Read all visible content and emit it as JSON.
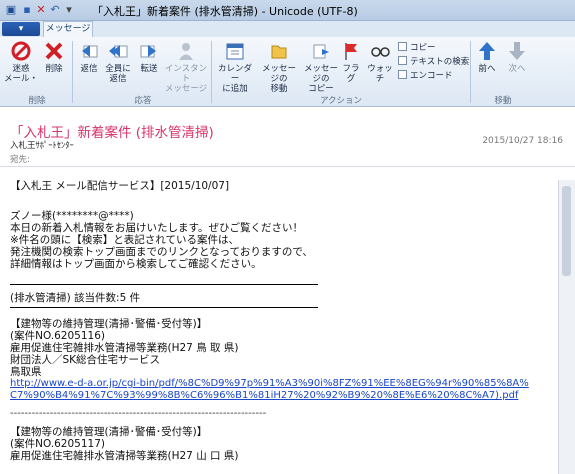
{
  "window": {
    "title": "「入札王」新着案件 (排水管清掃) - Unicode (UTF-8)"
  },
  "ribbon": {
    "file_tab": "▾",
    "active_tab": "メッセージ",
    "groups": {
      "delete": "削除",
      "respond": "応答",
      "actions": "アクション",
      "move": "移動"
    },
    "buttons": {
      "junk_1": "迷惑",
      "junk_2": "メール・",
      "delete": "削除",
      "reply": "返信",
      "reply_all_1": "全員に",
      "reply_all_2": "返信",
      "forward": "転送",
      "im_1": "インスタント",
      "im_2": "メッセージ",
      "calendar_1": "カレンダー",
      "calendar_2": "に追加",
      "move_msg_1": "メッセージの",
      "move_msg_2": "移動",
      "copy_msg_1": "メッセージの",
      "copy_msg_2": "コピー",
      "flag": "フラグ",
      "watch": "ウォッチ",
      "copy": "コピー",
      "find_text": "テキストの検索",
      "encode": "エンコード",
      "prev": "前へ",
      "next": "次へ"
    }
  },
  "message": {
    "subject": "「入札王」新着案件 (排水管清掃)",
    "sender": "入札王ｻﾎﾟｰﾄｾﾝﾀｰ",
    "date": "2015/10/27 18:16",
    "to_label": "宛先:"
  },
  "body": {
    "header": "【入札王 メール配信サービス】[2015/10/07]",
    "greeting": "ズノー様(********@****)",
    "intro": [
      "本日の新着入札情報をお届けいたします。ぜひご覧ください！",
      "※件名の頭に【検索】と表記されている案件は、",
      "発注機関の検索トップ画面までのリンクとなっておりますので、",
      "詳細情報はトップ画面から検索してご確認ください。"
    ],
    "summary": "(排水管清掃) 該当件数:5 件",
    "items": [
      {
        "title": "【建物等の維持管理(清掃･警備･受付等)】",
        "case": "(案件NO.6205116)",
        "name": "雇用促進住宅雑排水管清掃等業務(H27 鳥 取 県)",
        "org": "財団法人／SK総合住宅サービス",
        "pref": "鳥取県",
        "link_1": "http://www.e-d-a.or.jp/cgi-bin/pdf/%8C%D9%97p%91%A3%90i%8FZ%91%EE%8EG%94r%90%85%8A%",
        "link_2": "C7%90%B4%91%7C%93%99%8B%C6%96%B1%81iH27%20%92%B9%20%8E%E6%20%8C%A7).pdf"
      },
      {
        "title": "【建物等の維持管理(清掃･警備･受付等)】",
        "case": "(案件NO.6205117)",
        "name": "雇用促進住宅雑排水管清掃等業務(H27 山 口 県)"
      }
    ],
    "divider": "-----------------------------------------------------------------------"
  },
  "colors": {
    "subject": "#d6336c",
    "link": "#1a46c8"
  }
}
